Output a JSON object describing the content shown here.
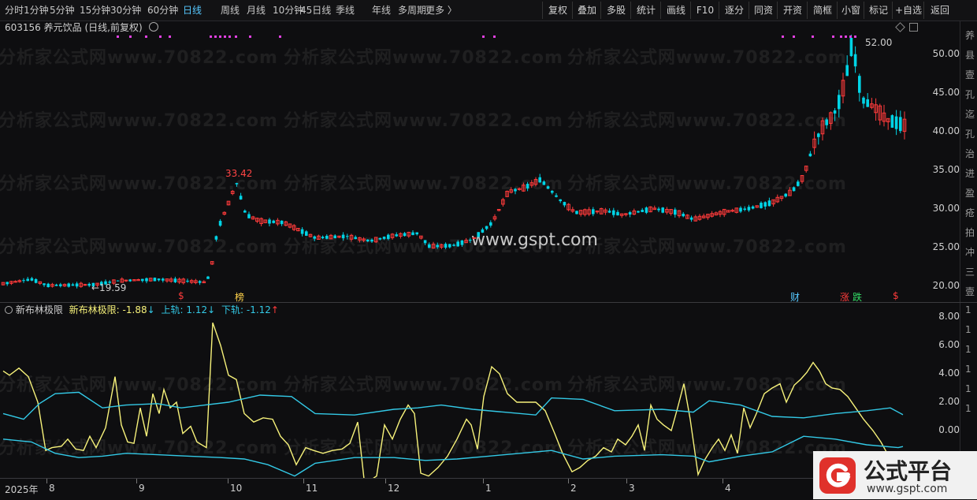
{
  "toolbar": {
    "timeframes": [
      "分时",
      "1分钟",
      "5分钟",
      "15分钟",
      "30分钟",
      "60分钟",
      "日线",
      "周线",
      "月线",
      "10分钟",
      "45日线",
      "季线",
      "年线",
      "多周期",
      "更多 〉"
    ],
    "active_timeframe": "日线",
    "tools": [
      "复权",
      "叠加",
      "多股",
      "统计",
      "画线",
      "F10",
      "逐分",
      "同资",
      "开资",
      "简框",
      "小窗",
      "标记",
      "+自选",
      "返回"
    ]
  },
  "title": {
    "code": "603156",
    "name": "养元饮品",
    "mode": "(日线,前复权)"
  },
  "price_axis": {
    "labels": [
      "50.00",
      "45.00",
      "40.00",
      "35.00",
      "30.00",
      "25.00",
      "20.00"
    ]
  },
  "annotations": {
    "high_label": "33.42",
    "low_label": "←19.59",
    "max_label": "52.00"
  },
  "events": {
    "s1": "$",
    "bang": "榜",
    "cai": "财",
    "zhang": "涨",
    "die": "跌",
    "s2": "$"
  },
  "watermark": "分析家公式网www.70822.com",
  "site_watermark": "www.gspt.com",
  "indicator": {
    "name": "新布林极限",
    "value_label": "新布林极限:",
    "value": "-1.88",
    "value_arrow": "↓",
    "upper_label": "上轨:",
    "upper_value": "1.12",
    "upper_arrow": "↓",
    "lower_label": "下轨:",
    "lower_value": "-1.12",
    "lower_arrow": "↑",
    "axis": [
      "8.00",
      "6.00",
      "4.00",
      "2.00",
      "0.00"
    ]
  },
  "xaxis": {
    "labels": [
      "2025年",
      "8",
      "9",
      "10",
      "11",
      "12",
      "1",
      "2",
      "3",
      "4"
    ]
  },
  "right_strip": [
    "养",
    "县",
    "壹",
    "孔",
    "迄",
    "孔",
    "治",
    "进",
    "盈",
    "疮",
    "拍",
    "冲",
    "三",
    "壹",
    "1",
    "1",
    "1",
    "1",
    "1",
    "1"
  ],
  "logo": {
    "name": "公式平台",
    "url": "www.gspt.com"
  },
  "colors": {
    "up": "#ff3b3b",
    "down": "#00d4e6",
    "line_main": "#f7f27a",
    "line_band": "#33c9e6",
    "active": "#56c8ff"
  }
}
